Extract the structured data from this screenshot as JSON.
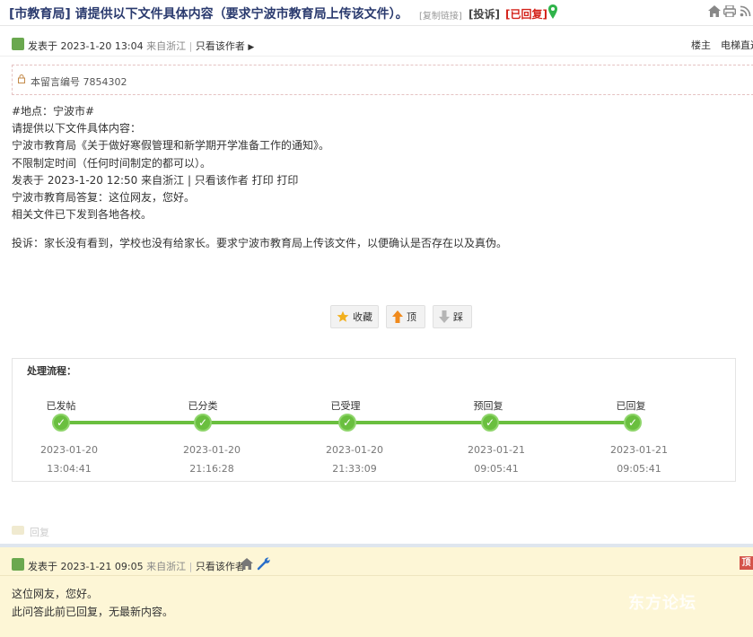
{
  "thread": {
    "title": "[市教育局] 请提供以下文件具体内容（要求宁波市教育局上传该文件）。",
    "copy_link": "[复制链接]",
    "tag_complaint": "[投诉]",
    "tag_replied": "[已回复]"
  },
  "post1": {
    "posted_at": "发表于 2023-1-20 13:04",
    "location": "来自浙江",
    "separator": "|",
    "author_only": "只看该作者",
    "floor": "楼主",
    "elevator": "电梯直达",
    "message_id": "本留言编号 7854302",
    "body_lines": [
      "#地点：宁波市#",
      "请提供以下文件具体内容：",
      "宁波市教育局《关于做好寒假管理和新学期开学准备工作的通知》。",
      "不限制定时间（任何时间制定的都可以）。",
      "发表于 2023-1-20 12:50 来自浙江 | 只看该作者 打印 打印",
      "宁波市教育局答复：这位网友，您好。",
      "相关文件已下发到各地各校。"
    ],
    "complaint": "投诉：家长没有看到，学校也没有给家长。要求宁波市教育局上传该文件，以便确认是否存在以及真伪。"
  },
  "actions": {
    "favorite": "收藏",
    "up": "顶",
    "down": "踩"
  },
  "process": {
    "title": "处理流程：",
    "steps": [
      {
        "label": "已发帖",
        "date": "2023-01-20",
        "time": "13:04:41"
      },
      {
        "label": "已分类",
        "date": "2023-01-20",
        "time": "21:16:28"
      },
      {
        "label": "已受理",
        "date": "2023-01-20",
        "time": "21:33:09"
      },
      {
        "label": "预回复",
        "date": "2023-01-21",
        "time": "09:05:41"
      },
      {
        "label": "已回复",
        "date": "2023-01-21",
        "time": "09:05:41"
      }
    ]
  },
  "reply_link": "回复",
  "post2": {
    "posted_at": "发表于 2023-1-21 09:05",
    "location": "来自浙江",
    "separator": "|",
    "author_only": "只看该作者",
    "top_badge": "顶",
    "body_lines": [
      "这位网友，您好。",
      "此问答此前已回复，无最新内容。"
    ]
  },
  "watermark": "东方论坛",
  "colors": {
    "accent_green": "#6abf3f",
    "replied_red": "#d4231b",
    "reply_bg": "#fdf6d6"
  }
}
